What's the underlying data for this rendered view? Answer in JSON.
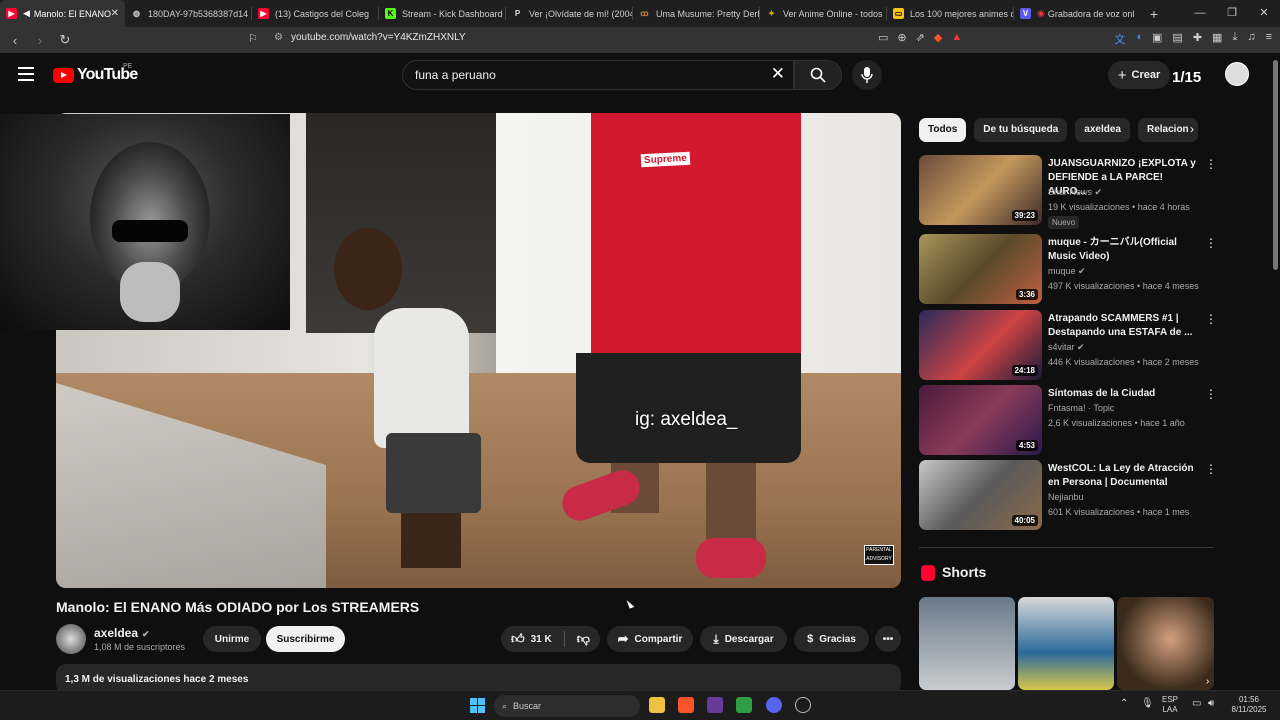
{
  "browser": {
    "tabs": [
      {
        "title": "Manolo: El ENANO",
        "color": "#ff0033",
        "glyph": "▶"
      },
      {
        "title": "180DAY-97b5368387d14",
        "color": "#888888",
        "glyph": "◍"
      },
      {
        "title": "(13) Castigos del Coleg",
        "color": "#ff0033",
        "glyph": "▶"
      },
      {
        "title": "Stream - Kick Dashboard",
        "color": "#53fc18",
        "glyph": "K"
      },
      {
        "title": "Ver ¡Olvídate de mí! (2004",
        "color": "#dddddd",
        "glyph": "P"
      },
      {
        "title": "Uma Musume: Pretty Derb",
        "color": "#d08a2a",
        "glyph": "ꝏ"
      },
      {
        "title": "Ver Anime Online - todos",
        "color": "#e6b800",
        "glyph": "✦"
      },
      {
        "title": "Los 100 mejores animes d",
        "color": "#f5c518",
        "glyph": "▭"
      },
      {
        "title": "Grabadora de voz onl",
        "color": "#5a5af0",
        "glyph": "V"
      }
    ],
    "url": "youtube.com/watch?v=Y4KZmZHXNLY"
  },
  "header": {
    "logo_text": "YouTube",
    "country": "PE",
    "search_value": "funa a peruano",
    "create_label": "Crear",
    "counter": "1/15"
  },
  "video": {
    "watermark": "ig: axeldea_",
    "shirt_text": "Supreme",
    "pa_label": "PARENTAL ADVISORY",
    "title": "Manolo: El ENANO Más ODIADO por Los STREAMERS",
    "channel": "axeldea",
    "subscribers": "1,08 M de suscriptores",
    "join_label": "Unirme",
    "subscribe_label": "Suscribirme",
    "likes": "31 K",
    "share_label": "Compartir",
    "download_label": "Descargar",
    "thanks_label": "Gracias",
    "views": "1,3 M de visualizaciones  hace 2 meses"
  },
  "sidebar": {
    "chips": [
      "Todos",
      "De tu búsqueda",
      "axeldea",
      "Relacion"
    ],
    "recommendations": [
      {
        "title": "JUANSGUARNIZO ¡EXPLOTA y DEFIENDE a LA PARCE! AURO...",
        "channel": "Shur News",
        "verified": true,
        "meta": "19 K visualizaciones • hace 4 horas",
        "duration": "39:23",
        "badge": "Nuevo",
        "thumb_color": "#8a5a3a"
      },
      {
        "title": "muque - カーニバル(Official Music Video)",
        "channel": "muque",
        "verified": true,
        "meta": "497 K visualizaciones • hace 4 meses",
        "duration": "3:36",
        "badge": "",
        "thumb_color": "#7a6a3a"
      },
      {
        "title": "Atrapando SCAMMERS #1 | Destapando una ESTAFA de ...",
        "channel": "s4vitar",
        "verified": true,
        "meta": "446 K visualizaciones • hace 2 meses",
        "duration": "24:18",
        "badge": "",
        "thumb_color": "#3a3a6a"
      },
      {
        "title": "Síntomas de la Ciudad",
        "channel": "Fntasma! · Topic",
        "verified": false,
        "meta": "2,6 K visualizaciones • hace 1 año",
        "duration": "4:53",
        "badge": "",
        "thumb_color": "#5a2a4a"
      },
      {
        "title": "WestCOL: La Ley de Atracción en Persona | Documental",
        "channel": "Nejianbu",
        "verified": false,
        "meta": "601 K visualizaciones • hace 1 mes",
        "duration": "40:05",
        "badge": "",
        "thumb_color": "#6a6a6a"
      }
    ],
    "shorts_title": "Shorts"
  },
  "taskbar": {
    "search_label": "Buscar",
    "lang_top": "ESP",
    "lang_bottom": "LAA",
    "time": "01:56",
    "date": "8/11/2025"
  }
}
